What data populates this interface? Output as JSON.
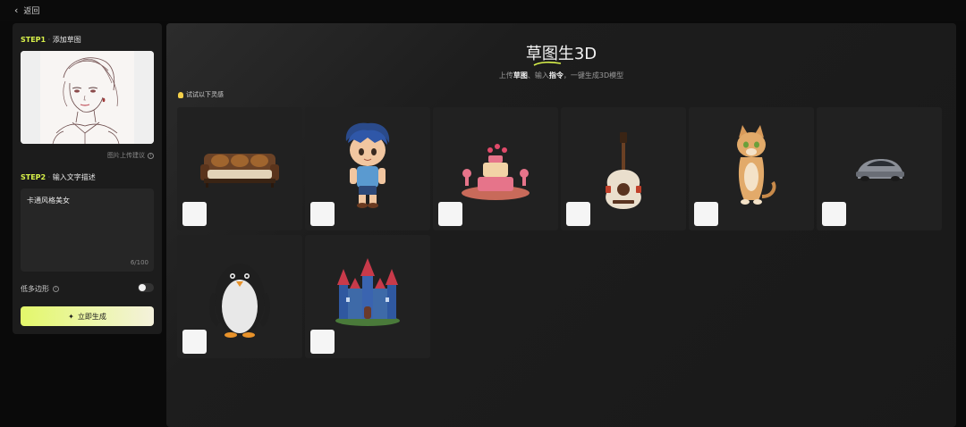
{
  "topbar": {
    "back_label": "返回"
  },
  "panel": {
    "step1_num": "STEP1",
    "step1_sep": "·",
    "step1_label": "添加草图",
    "hint": "图片上传建议",
    "step2_num": "STEP2",
    "step2_sep": "·",
    "step2_label": "输入文字描述",
    "prompt_value": "卡通风格美女",
    "counter": "6/100",
    "lowpoly_label": "低多边形",
    "lowpoly_on": false,
    "generate_label": "立即生成",
    "generate_icon": "sparkle-icon"
  },
  "main": {
    "title": "草图生3D",
    "subtitle_pre": "上传",
    "subtitle_b1": "草图",
    "subtitle_mid": "、输入",
    "subtitle_b2": "指令",
    "subtitle_post": "，一键生成3D模型",
    "inspire_label": "试试以下灵感",
    "examples": [
      "sofa",
      "boy",
      "cake",
      "guitar",
      "cat",
      "car",
      "penguin",
      "castle"
    ]
  },
  "colors": {
    "accent": "#d9f24a",
    "panel": "#1c1c1c",
    "card": "#212121"
  }
}
